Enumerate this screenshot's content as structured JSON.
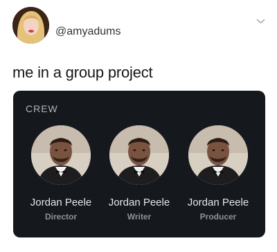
{
  "tweet": {
    "handle": "@amyadums",
    "text": "me in a group project"
  },
  "card": {
    "section_label": "CREW",
    "members": [
      {
        "name": "Jordan Peele",
        "role": "Director"
      },
      {
        "name": "Jordan Peele",
        "role": "Writer"
      },
      {
        "name": "Jordan Peele",
        "role": "Producer"
      }
    ]
  },
  "icons": {
    "menu": "chevron-down-icon"
  },
  "colors": {
    "card_background": "#15181d",
    "page_background": "#ffffff"
  }
}
